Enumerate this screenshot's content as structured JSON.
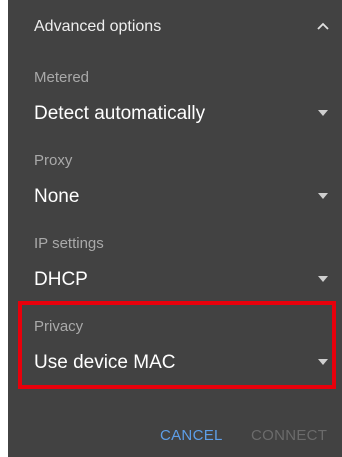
{
  "advanced": {
    "title": "Advanced options",
    "toggle_icon": "chevron-up-icon"
  },
  "fields": {
    "metered": {
      "label": "Metered",
      "value": "Detect automatically"
    },
    "proxy": {
      "label": "Proxy",
      "value": "None"
    },
    "ip_settings": {
      "label": "IP settings",
      "value": "DHCP"
    },
    "privacy": {
      "label": "Privacy",
      "value": "Use device MAC"
    }
  },
  "actions": {
    "cancel_label": "CANCEL",
    "connect_label": "CONNECT"
  },
  "colors": {
    "dialog_bg": "#424242",
    "accent": "#5d9ee8",
    "disabled": "#6b6b6b",
    "highlight": "#e8000b",
    "label": "#a9a9a9"
  }
}
